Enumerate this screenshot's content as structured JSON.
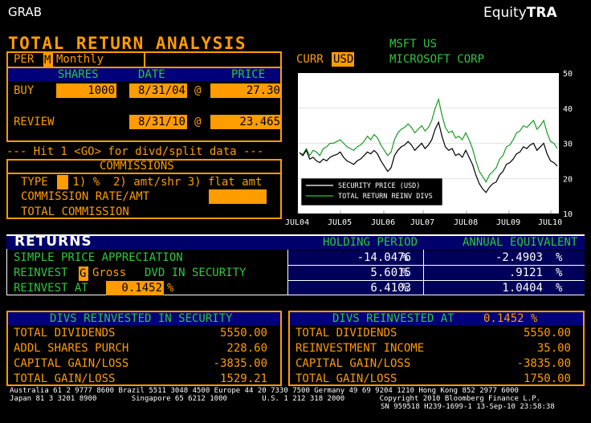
{
  "header": {
    "left": "GRAB",
    "right_prefix": "Equity",
    "right_bold": "TRA"
  },
  "title": "TOTAL RETURN ANALYSIS",
  "security": {
    "ticker": "MSFT US",
    "name": "MICROSOFT CORP"
  },
  "currency": {
    "label": "CURR",
    "value": "USD"
  },
  "period": {
    "label": "PER",
    "code": "M",
    "text": "Monthly"
  },
  "columns": {
    "shares": "SHARES",
    "date": "DATE",
    "price": "PRICE"
  },
  "buy": {
    "label": "BUY",
    "shares": "1000",
    "date": "8/31/04",
    "at": "@",
    "price": "27.30"
  },
  "review": {
    "label": "REVIEW",
    "date": "8/31/10",
    "at": "@",
    "price": "23.465"
  },
  "hint": "--- Hit 1 <GO> for divd/split data ---",
  "commissions": {
    "title": "COMMISSIONS",
    "type_label": "TYPE",
    "type_options": " 1) %  2) amt/shr 3) flat amt",
    "rate_label": "COMMISSION RATE/AMT",
    "total_label": "TOTAL COMMISSION"
  },
  "chart_data": {
    "type": "line",
    "x_tick_labels": [
      "JUL04",
      "JUL05",
      "JUL06",
      "JUL07",
      "JUL08",
      "JUL09",
      "JUL10"
    ],
    "y_ticks": [
      "50",
      "40",
      "30",
      "20",
      "10"
    ],
    "ylim": [
      10,
      50
    ],
    "legend": [
      "SECURITY PRICE (USD)",
      "TOTAL RETURN REINV DIVS"
    ],
    "series": [
      {
        "name": "SECURITY PRICE (USD)",
        "color": "#ffffff",
        "values": [
          27.3,
          26.5,
          28.0,
          25.5,
          26.0,
          25.0,
          24.5,
          25.5,
          25.0,
          26.0,
          26.5,
          26.8,
          27.5,
          26.0,
          25.0,
          24.5,
          24.0,
          25.0,
          25.5,
          26.5,
          27.5,
          27.0,
          28.0,
          27.0,
          25.0,
          23.5,
          22.0,
          23.0,
          26.5,
          28.0,
          29.0,
          29.5,
          30.5,
          29.5,
          28.0,
          29.0,
          30.0,
          28.5,
          29.5,
          31.0,
          34.0,
          36.0,
          32.0,
          29.0,
          28.0,
          28.5,
          26.5,
          27.0,
          26.0,
          28.0,
          26.0,
          24.0,
          21.0,
          18.5,
          17.0,
          16.0,
          17.5,
          18.5,
          19.0,
          21.0,
          22.0,
          24.0,
          24.5,
          25.5,
          27.0,
          27.5,
          29.0,
          28.5,
          29.5,
          30.0,
          28.0,
          29.0,
          30.0,
          27.0,
          25.0,
          24.5,
          23.5
        ]
      },
      {
        "name": "TOTAL RETURN REINV DIVS",
        "color": "#2fc63b",
        "values": [
          27.3,
          26.8,
          28.5,
          26.5,
          28.0,
          27.5,
          26.5,
          28.5,
          29.0,
          30.0,
          30.0,
          30.5,
          31.0,
          30.0,
          29.0,
          28.5,
          28.0,
          29.0,
          29.5,
          30.5,
          32.0,
          31.0,
          32.5,
          31.5,
          29.5,
          28.0,
          26.5,
          27.5,
          31.0,
          33.0,
          34.0,
          34.5,
          35.5,
          34.5,
          33.0,
          34.0,
          35.0,
          33.5,
          34.5,
          36.5,
          40.0,
          42.5,
          38.0,
          34.5,
          33.0,
          33.5,
          31.5,
          32.0,
          31.0,
          33.0,
          31.0,
          28.5,
          25.0,
          22.0,
          20.5,
          19.0,
          21.0,
          22.0,
          23.0,
          25.5,
          26.5,
          29.0,
          29.5,
          31.0,
          33.0,
          33.5,
          35.0,
          34.5,
          35.5,
          36.5,
          34.0,
          35.0,
          36.5,
          33.0,
          30.5,
          30.0,
          28.5
        ]
      }
    ]
  },
  "returns": {
    "title": "RETURNS",
    "col_holding": "HOLDING PERIOD",
    "col_annual": "ANNUAL EQUIVALENT",
    "rows": [
      {
        "label": "SIMPLE PRICE APPRECIATION",
        "holding": "-14.0476",
        "annual": "-2.4903",
        "unit": "%"
      },
      {
        "label": "REINVEST",
        "code": "G",
        "code_text": "Gross",
        "tail": "DVD IN SECURITY",
        "holding": "5.6015",
        "annual": ".9121",
        "unit": "%"
      },
      {
        "label": "REINVEST AT",
        "rate": "0.1452",
        "rate_unit": "%",
        "holding": "6.4103",
        "annual": "1.0404",
        "unit": "%"
      }
    ]
  },
  "divs_security": {
    "title": "DIVS REINVESTED IN SECURITY",
    "rows": [
      {
        "label": "TOTAL DIVIDENDS",
        "value": "5550.00"
      },
      {
        "label": "ADDL SHARES PURCH",
        "value": "228.60"
      },
      {
        "label": "CAPITAL GAIN/LOSS",
        "value": "-3835.00"
      },
      {
        "label": "TOTAL GAIN/LOSS",
        "value": "1529.21"
      }
    ]
  },
  "divs_at": {
    "title": "DIVS REINVESTED AT",
    "rate": "0.1452 %",
    "rows": [
      {
        "label": "TOTAL DIVIDENDS",
        "value": "5550.00"
      },
      {
        "label": "REINVESTMENT INCOME",
        "value": "35.00"
      },
      {
        "label": "CAPITAL GAIN/LOSS",
        "value": "-3835.00"
      },
      {
        "label": "TOTAL GAIN/LOSS",
        "value": "1750.00"
      }
    ]
  },
  "footer": {
    "line1": "Australia 61 2 9777 8600 Brazil 5511 3048 4500 Europe 44 20 7330 7500 Germany 49 69 9204 1210 Hong Kong 852 2977 6000",
    "line2": "Japan 81 3 3201 8900        Singapore 65 6212 1000        U.S. 1 212 318 2000        Copyright 2010 Bloomberg Finance L.P.",
    "line3": "SN 959518 H239-1699-1 13-Sep-10 23:58:38"
  }
}
